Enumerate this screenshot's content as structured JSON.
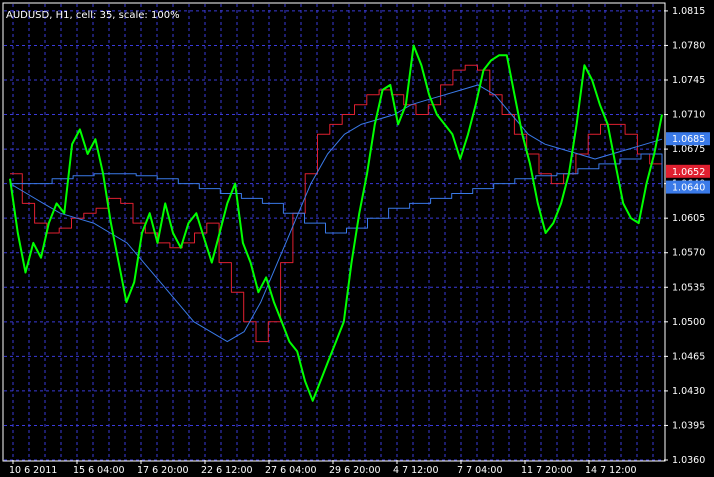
{
  "header": {
    "label": "AUDUSD, H1, cell: 35, scale: 100%"
  },
  "colors": {
    "background": "#000000",
    "grid": "#3a3ad8",
    "frame": "#ffffff",
    "price": "#00ff00",
    "ma_red": "#e02030",
    "ma_blue": "#3a7ae8",
    "badge_blue": "#3a7ae8",
    "badge_red": "#e02030"
  },
  "chart_data": {
    "type": "line",
    "title": "AUDUSD, H1, cell: 35, scale: 100%",
    "ylim": [
      1.036,
      1.0822
    ],
    "y_ticks": [
      "1.0815",
      "1.0780",
      "1.0745",
      "1.0710",
      "1.0675",
      "1.0640",
      "1.0605",
      "1.0570",
      "1.0535",
      "1.0500",
      "1.0465",
      "1.0430",
      "1.0395",
      "1.0360"
    ],
    "x_ticks": [
      "10 6 2011",
      "15 6 04:00",
      "17 6 20:00",
      "22 6 12:00",
      "27 6 04:00",
      "29 6 20:00",
      "4 7 12:00",
      "7 7 04:00",
      "11 7 20:00",
      "14 7 12:00"
    ],
    "price_labels": [
      {
        "name": "blue",
        "text": "1.0685",
        "value": 1.0685
      },
      {
        "name": "red",
        "text": "1.0652",
        "value": 1.0652
      },
      {
        "name": "blue-partial",
        "text": "1.0640",
        "value": 1.0636
      }
    ],
    "series": [
      {
        "key": "price",
        "values": [
          1.0645,
          1.059,
          1.055,
          1.058,
          1.0565,
          1.06,
          1.062,
          1.061,
          1.068,
          1.0695,
          1.067,
          1.0685,
          1.065,
          1.06,
          1.056,
          1.052,
          1.054,
          1.059,
          1.061,
          1.058,
          1.062,
          1.059,
          1.0575,
          1.06,
          1.061,
          1.0585,
          1.056,
          1.059,
          1.062,
          1.064,
          1.058,
          1.056,
          1.053,
          1.0545,
          1.052,
          1.05,
          1.048,
          1.047,
          1.044,
          1.042,
          1.044,
          1.046,
          1.048,
          1.05,
          1.056,
          1.061,
          1.065,
          1.07,
          1.0735,
          1.074,
          1.07,
          1.072,
          1.078,
          1.076,
          1.073,
          1.071,
          1.07,
          1.069,
          1.0665,
          1.069,
          1.072,
          1.0755,
          1.0765,
          1.077,
          1.077,
          1.073,
          1.069,
          1.066,
          1.062,
          1.059,
          1.06,
          1.062,
          1.065,
          1.07,
          1.076,
          1.0745,
          1.072,
          1.07,
          1.066,
          1.062,
          1.0605,
          1.06,
          1.064,
          1.067,
          1.071
        ]
      },
      {
        "key": "ma_red",
        "values": [
          1.065,
          1.062,
          1.06,
          1.059,
          1.0595,
          1.0605,
          1.061,
          1.0615,
          1.0625,
          1.062,
          1.06,
          1.059,
          1.058,
          1.0575,
          1.058,
          1.059,
          1.06,
          1.056,
          1.053,
          1.05,
          1.048,
          1.05,
          1.056,
          1.061,
          1.065,
          1.069,
          1.07,
          1.071,
          1.072,
          1.073,
          1.0735,
          1.073,
          1.072,
          1.071,
          1.072,
          1.074,
          1.0755,
          1.076,
          1.0755,
          1.073,
          1.071,
          1.069,
          1.067,
          1.065,
          1.064,
          1.065,
          1.067,
          1.069,
          1.07,
          1.07,
          1.069,
          1.067,
          1.066,
          1.0652
        ]
      },
      {
        "key": "ma_blue_fast",
        "values": [
          1.064,
          1.063,
          1.062,
          1.061,
          1.0605,
          1.06,
          1.059,
          1.058,
          1.056,
          1.054,
          1.052,
          1.05,
          1.049,
          1.048,
          1.049,
          1.052,
          1.056,
          1.06,
          1.064,
          1.067,
          1.069,
          1.07,
          1.0705,
          1.071,
          1.072,
          1.0725,
          1.073,
          1.0735,
          1.074,
          1.073,
          1.071,
          1.069,
          1.068,
          1.0675,
          1.067,
          1.0665,
          1.067,
          1.0675,
          1.068,
          1.0685
        ]
      },
      {
        "key": "ma_blue_slow",
        "values": [
          1.064,
          1.064,
          1.0645,
          1.0648,
          1.065,
          1.065,
          1.0648,
          1.0645,
          1.064,
          1.0635,
          1.063,
          1.0625,
          1.062,
          1.061,
          1.06,
          1.059,
          1.0595,
          1.0605,
          1.0615,
          1.062,
          1.0625,
          1.063,
          1.0635,
          1.064,
          1.0645,
          1.0648,
          1.065,
          1.0655,
          1.066,
          1.0665,
          1.067,
          1.0636
        ]
      }
    ]
  }
}
